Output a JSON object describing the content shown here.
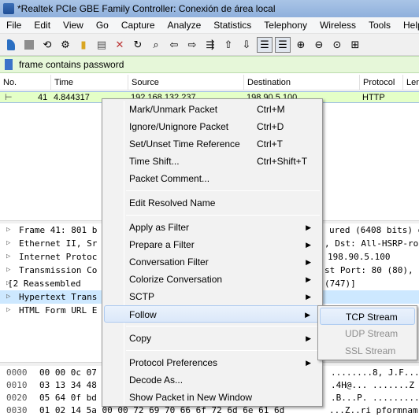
{
  "window": {
    "title": "*Realtek PCIe GBE Family Controller: Conexión de área local"
  },
  "menubar": {
    "items": [
      "File",
      "Edit",
      "View",
      "Go",
      "Capture",
      "Analyze",
      "Statistics",
      "Telephony",
      "Wireless",
      "Tools",
      "Help"
    ]
  },
  "toolbar": {
    "icons": [
      "shark-fin-icon",
      "stop-icon",
      "restart-icon",
      "options-gear-icon",
      "open-folder-icon",
      "save-file-icon",
      "close-file-icon",
      "reload-icon",
      "find-icon",
      "back-arrow-icon",
      "forward-arrow-icon",
      "go-to-packet-icon",
      "first-packet-icon",
      "last-packet-icon",
      "autoscroll-icon",
      "colorize-icon",
      "zoom-in-icon",
      "zoom-out-icon",
      "normal-size-icon",
      "resize-columns-icon"
    ]
  },
  "filter": {
    "value": "frame contains password"
  },
  "packet_list": {
    "columns": [
      "No.",
      "Time",
      "Source",
      "Destination",
      "Protocol",
      "Len"
    ],
    "row": {
      "no": "41",
      "time": "4.844317",
      "source": "192.168.132.237",
      "destination": "198.90.5.100",
      "protocol": "HTTP"
    }
  },
  "details": {
    "rows": [
      {
        "left": "Frame 41: 801 b",
        "right": "ured (6408 bits) o"
      },
      {
        "left": "Ethernet II, Sr",
        "right": ", Dst: All-HSRP-ro"
      },
      {
        "left": "Internet Protoc",
        "right": "198.90.5.100"
      },
      {
        "left": "Transmission Co",
        "right": "st Port: 80 (80),"
      },
      {
        "left": "[2 Reassembled",
        "right": "(747)]"
      },
      {
        "left": "Hypertext Trans",
        "right": ""
      },
      {
        "left": "HTML Form URL E",
        "right": ""
      }
    ]
  },
  "bytes": {
    "rows": [
      {
        "offset": "0000",
        "hex": "00 00 0c 07",
        "ascii": "........8, J.F...E."
      },
      {
        "offset": "0010",
        "hex": "03 13 34 48",
        "ascii": ".4H@...    .......Z"
      },
      {
        "offset": "0020",
        "hex": "05 64 0f bd",
        "ascii": ".B...P.  .........."
      },
      {
        "offset": "0030",
        "hex": "01 02 14 5a 00 00 72 69  70 66 6f 72 6d 6e 61 6d",
        "ascii": "...Z..ri pformnam"
      }
    ]
  },
  "context_menu": {
    "items": [
      {
        "label": "Mark/Unmark Packet",
        "shortcut": "Ctrl+M"
      },
      {
        "label": "Ignore/Unignore Packet",
        "shortcut": "Ctrl+D"
      },
      {
        "label": "Set/Unset Time Reference",
        "shortcut": "Ctrl+T"
      },
      {
        "label": "Time Shift...",
        "shortcut": "Ctrl+Shift+T"
      },
      {
        "label": "Packet Comment..."
      },
      {
        "label": "Edit Resolved Name"
      },
      {
        "label": "Apply as Filter"
      },
      {
        "label": "Prepare a Filter"
      },
      {
        "label": "Conversation Filter"
      },
      {
        "label": "Colorize Conversation"
      },
      {
        "label": "SCTP"
      },
      {
        "label": "Follow"
      },
      {
        "label": "Copy"
      },
      {
        "label": "Protocol Preferences"
      },
      {
        "label": "Decode As..."
      },
      {
        "label": "Show Packet in New Window"
      }
    ]
  },
  "follow_submenu": {
    "items": [
      {
        "label": "TCP Stream"
      },
      {
        "label": "UDP Stream"
      },
      {
        "label": "SSL Stream"
      }
    ]
  }
}
